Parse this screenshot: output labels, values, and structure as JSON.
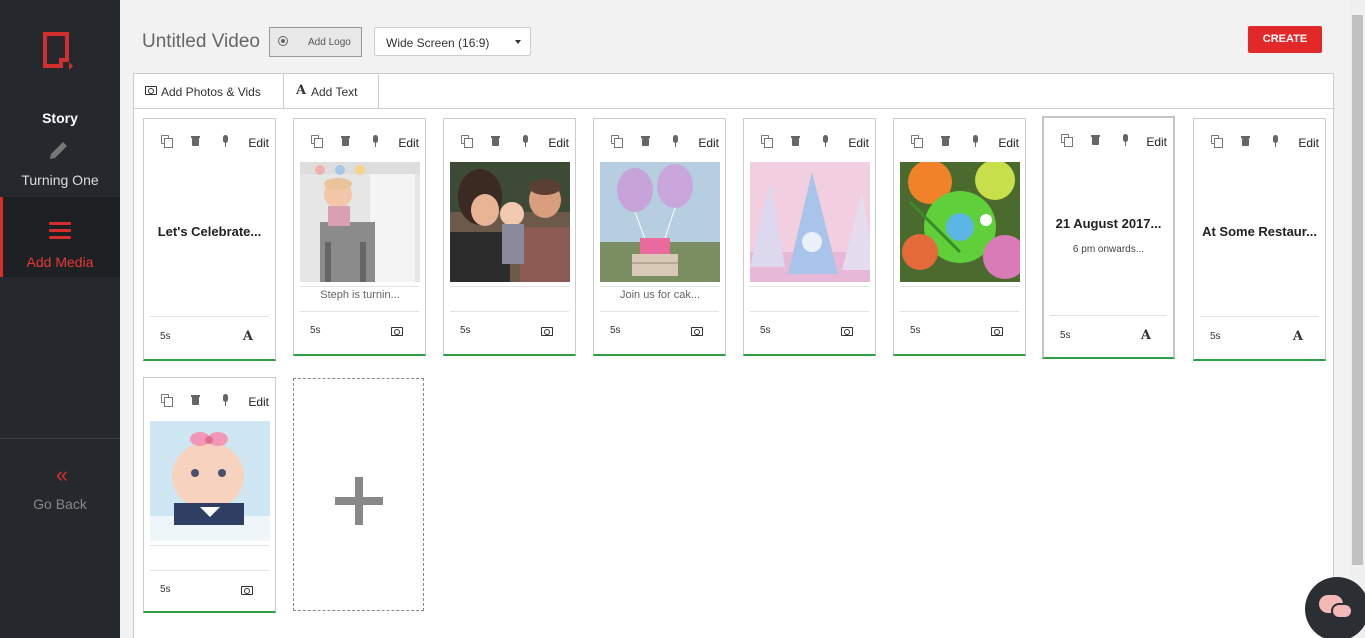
{
  "sidebar": {
    "story_label": "Story",
    "project_name": "Turning One",
    "add_media_label": "Add Media",
    "go_back_label": "Go Back",
    "go_back_icon": "«"
  },
  "header": {
    "title": "Untitled Video",
    "add_logo_label": "Add Logo",
    "aspect_ratio": "Wide Screen (16:9)",
    "create_label": "CREATE"
  },
  "toolbar": {
    "add_photos_label": "Add Photos & Vids",
    "add_text_label": "Add Text",
    "text_icon_glyph": "A"
  },
  "card_actions": {
    "edit_label": "Edit"
  },
  "slides": [
    {
      "kind": "text",
      "heading": "Let's Celebrate...",
      "sub": "",
      "duration": "5s",
      "type_icon": "text-icon"
    },
    {
      "kind": "photo",
      "caption": "Steph is turnin...",
      "duration": "5s",
      "type_icon": "camera-icon",
      "image": "baby-on-chair"
    },
    {
      "kind": "photo",
      "caption": "",
      "duration": "5s",
      "type_icon": "camera-icon",
      "image": "parents-kissing-baby"
    },
    {
      "kind": "photo",
      "caption": "Join us for cak...",
      "duration": "5s",
      "type_icon": "camera-icon",
      "image": "balloons-cake"
    },
    {
      "kind": "photo",
      "caption": "",
      "duration": "5s",
      "type_icon": "camera-icon",
      "image": "party-hats"
    },
    {
      "kind": "photo",
      "caption": "",
      "duration": "5s",
      "type_icon": "camera-icon",
      "image": "cupcakes"
    },
    {
      "kind": "text",
      "heading": "21 August 2017...",
      "sub": "6 pm onwards...",
      "duration": "5s",
      "type_icon": "text-icon",
      "selected": true
    },
    {
      "kind": "text",
      "heading": "At Some Restaur...",
      "sub": "",
      "duration": "5s",
      "type_icon": "text-icon"
    },
    {
      "kind": "photo",
      "caption": "",
      "duration": "5s",
      "type_icon": "camera-icon",
      "image": "baby-with-bow"
    }
  ],
  "colors": {
    "accent": "#e22828",
    "sidebar_bg": "#25282c",
    "card_bottom": "#2e9e48"
  }
}
